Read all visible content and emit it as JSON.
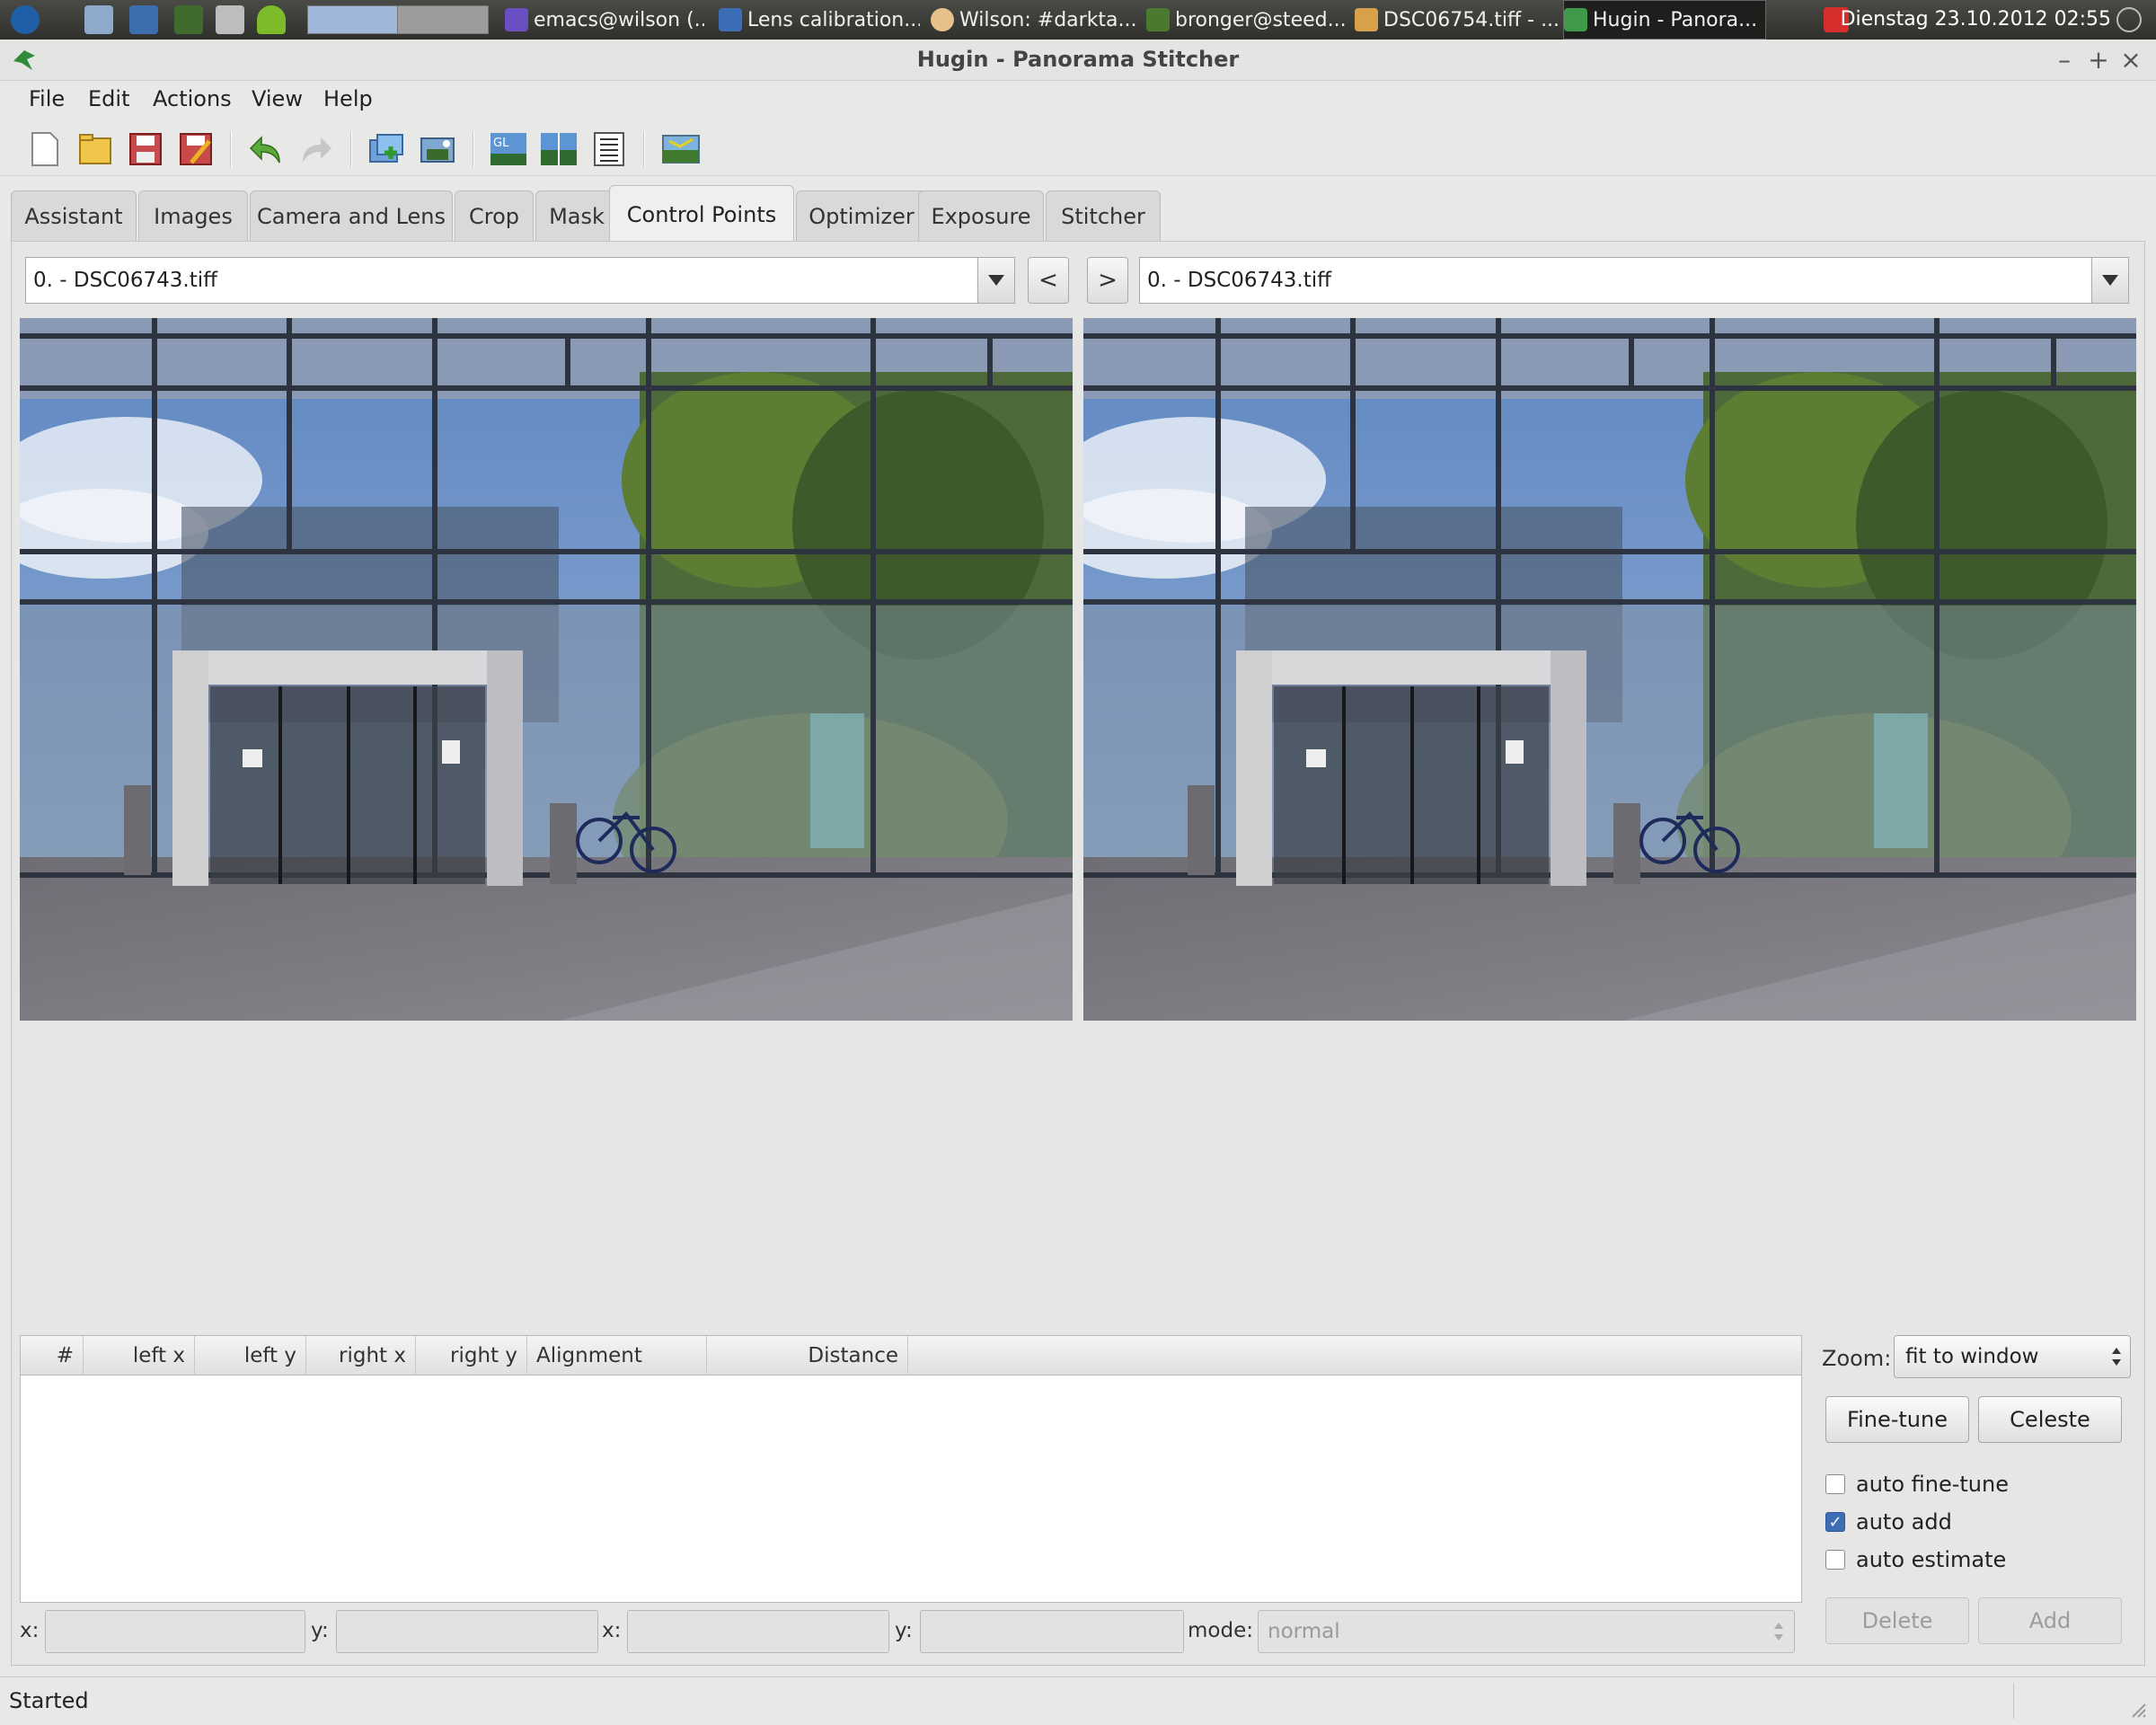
{
  "taskbar": {
    "tasks": [
      {
        "label": "emacs@wilson (...",
        "icon": "emacs-icon"
      },
      {
        "label": "Lens calibration...",
        "icon": "browser-icon"
      },
      {
        "label": "Wilson: #darkta...",
        "icon": "chat-icon"
      },
      {
        "label": "bronger@steed...",
        "icon": "terminal-icon"
      },
      {
        "label": "DSC06754.tiff - ...",
        "icon": "image-viewer-icon"
      },
      {
        "label": "Hugin - Panora...",
        "icon": "hugin-icon"
      }
    ],
    "clock": "Dienstag 23.10.2012 02:55"
  },
  "window": {
    "title": "Hugin - Panorama Stitcher"
  },
  "menu": [
    "File",
    "Edit",
    "Actions",
    "View",
    "Help"
  ],
  "toolbar": {
    "icons": [
      "new-project-icon",
      "open-project-icon",
      "save-icon",
      "save-as-icon",
      "undo-icon",
      "redo-icon",
      "add-images-icon",
      "add-time-series-icon",
      "fast-preview-gl-icon",
      "preview-icon",
      "control-point-list-icon",
      "optimize-icon"
    ]
  },
  "tabs": [
    {
      "label": "Assistant",
      "selected": false
    },
    {
      "label": "Images",
      "selected": false
    },
    {
      "label": "Camera and Lens",
      "selected": false
    },
    {
      "label": "Crop",
      "selected": false
    },
    {
      "label": "Mask",
      "selected": false
    },
    {
      "label": "Control Points",
      "selected": true
    },
    {
      "label": "Optimizer",
      "selected": false
    },
    {
      "label": "Exposure",
      "selected": false
    },
    {
      "label": "Stitcher",
      "selected": false
    }
  ],
  "control_points": {
    "left_image": "0. - DSC06743.tiff",
    "right_image": "0. - DSC06743.tiff",
    "prev_label": "<",
    "next_label": ">",
    "table_columns": [
      "#",
      "left x",
      "left y",
      "right x",
      "right y",
      "Alignment",
      "Distance"
    ],
    "rows": [],
    "fields": {
      "left_x_label": "x:",
      "left_y_label": "y:",
      "right_x_label": "x:",
      "right_y_label": "y:",
      "left_x": "",
      "left_y": "",
      "right_x": "",
      "right_y": "",
      "mode_label": "mode:",
      "mode_value": "normal"
    },
    "zoom_label": "Zoom:",
    "zoom_value": "fit to window",
    "buttons": {
      "fine_tune": "Fine-tune",
      "celeste": "Celeste",
      "delete": "Delete",
      "add": "Add"
    },
    "options": [
      {
        "label": "auto fine-tune",
        "checked": false
      },
      {
        "label": "auto add",
        "checked": true
      },
      {
        "label": "auto estimate",
        "checked": false
      }
    ]
  },
  "status": {
    "text": "Started"
  },
  "colors": {
    "selected_tab": "#efefee",
    "checkbox_accent": "#3c6db5",
    "taskbar": "#3a3a37"
  }
}
